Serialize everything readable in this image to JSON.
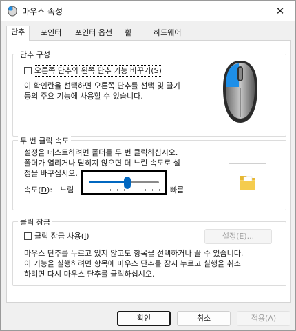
{
  "window": {
    "title": "마우스 속성",
    "close_glyph": "✕"
  },
  "tabs": [
    {
      "label": "단추",
      "active": true
    },
    {
      "label": "포인터",
      "active": false
    },
    {
      "label": "포인터 옵션",
      "active": false
    },
    {
      "label": "휠",
      "active": false
    },
    {
      "label": "하드웨어",
      "active": false
    }
  ],
  "button_config": {
    "title": "단추 구성",
    "swap_label_pre": "오른쪽 단추와 왼쪽 단추 기능 바꾸기(",
    "swap_label_key": "S",
    "swap_label_post": ")",
    "swap_checked": false,
    "desc_line1": "이 확인란을 선택하면 오른쪽 단추를 선택 및 끌기",
    "desc_line2": "등의 주요 기능에 사용할 수 있습니다."
  },
  "double_click": {
    "title": "두 번 클릭 속도",
    "desc_line1": "설정을 테스트하려면 폴더를 두 번 클릭하십시오.",
    "desc_line2": "폴더가 열리거나 닫히지 않으면 더 느린 속도로 설",
    "desc_line3": "정을 바꾸십시오.",
    "speed_label_pre": "속도(",
    "speed_label_key": "D",
    "speed_label_post": "):",
    "slow_label": "느림",
    "fast_label": "빠름",
    "speed_fraction": 0.55,
    "tick_count": 11
  },
  "click_lock": {
    "title": "클릭 잠금",
    "checkbox_label_pre": "클릭 잠금 사용(",
    "checkbox_label_key": "I",
    "checkbox_label_post": ")",
    "checked": false,
    "settings_button": "설정(E)...",
    "desc_line1": "마우스 단추를 누르고 있지 않고도 항목을 선택하거나 끌 수 있습니다.",
    "desc_line2": "이 기능을 실행하려면 항목에 마우스 단추를 잠시 누르고 실행을 취소",
    "desc_line3": "하려면 다시 마우스 단추를 클릭하십시오."
  },
  "footer": {
    "ok": "확인",
    "cancel": "취소",
    "apply": "적용(A)"
  },
  "colors": {
    "accent": "#0067c0",
    "mouse_highlight": "#1e8fe8"
  }
}
